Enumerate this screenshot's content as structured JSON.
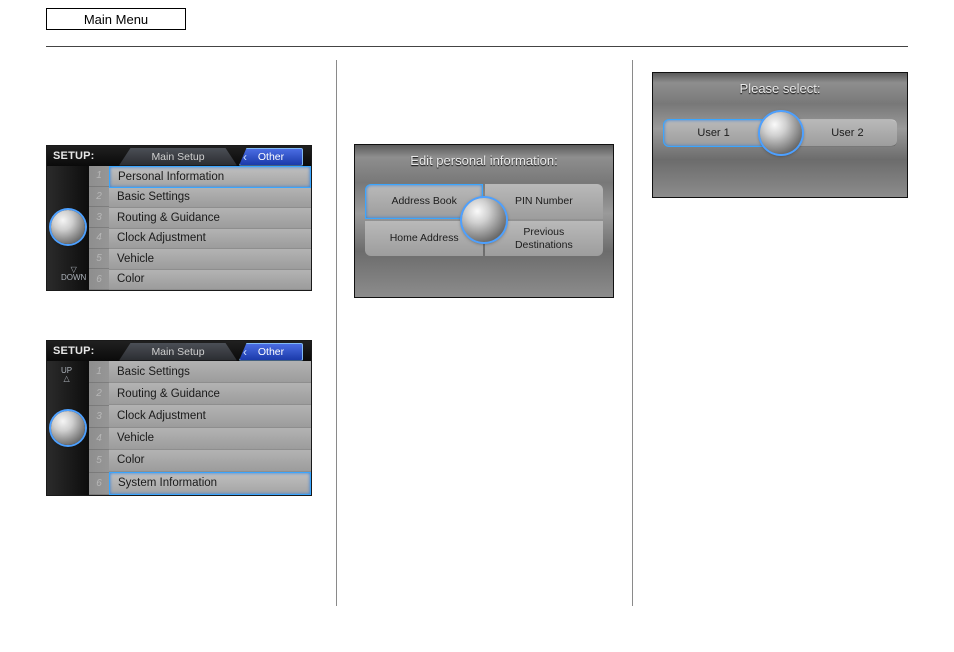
{
  "header": {
    "main_menu": "Main Menu"
  },
  "setup1": {
    "label": "SETUP:",
    "tab_main": "Main Setup",
    "tab_other": "Other",
    "items": [
      {
        "n": "1",
        "label": "Personal Information",
        "selected": true
      },
      {
        "n": "2",
        "label": "Basic Settings"
      },
      {
        "n": "3",
        "label": "Routing & Guidance"
      },
      {
        "n": "4",
        "label": "Clock Adjustment"
      },
      {
        "n": "5",
        "label": "Vehicle"
      },
      {
        "n": "6",
        "label": "Color"
      }
    ],
    "arrow_down": "▽\nDOWN"
  },
  "setup2": {
    "label": "SETUP:",
    "tab_main": "Main Setup",
    "tab_other": "Other",
    "items": [
      {
        "n": "1",
        "label": "Basic Settings"
      },
      {
        "n": "2",
        "label": "Routing & Guidance"
      },
      {
        "n": "3",
        "label": "Clock Adjustment"
      },
      {
        "n": "4",
        "label": "Vehicle"
      },
      {
        "n": "5",
        "label": "Color"
      },
      {
        "n": "6",
        "label": "System Information",
        "selected": true
      }
    ],
    "arrow_up": "UP\n△"
  },
  "personal": {
    "title": "Edit personal information:",
    "tl": "Address Book",
    "tr": "PIN Number",
    "bl": "Home Address",
    "br": "Previous\nDestinations"
  },
  "userselect": {
    "title": "Please select:",
    "left": "User 1",
    "right": "User 2"
  }
}
